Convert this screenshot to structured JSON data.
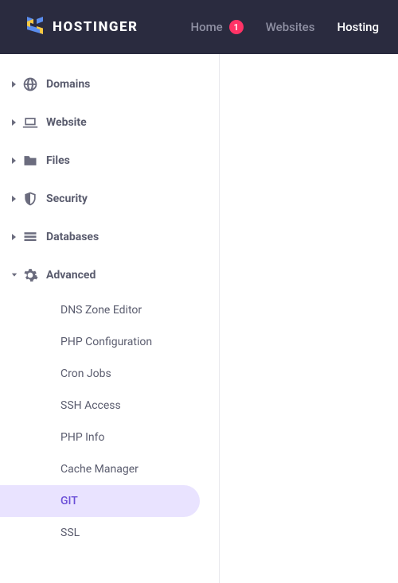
{
  "header": {
    "brand": "HOSTINGER",
    "nav": {
      "home": "Home",
      "home_badge": "1",
      "websites": "Websites",
      "hosting": "Hosting"
    }
  },
  "sidebar": {
    "items": [
      {
        "label": "Domains",
        "expanded": false
      },
      {
        "label": "Website",
        "expanded": false
      },
      {
        "label": "Files",
        "expanded": false
      },
      {
        "label": "Security",
        "expanded": false
      },
      {
        "label": "Databases",
        "expanded": false
      },
      {
        "label": "Advanced",
        "expanded": true
      }
    ],
    "advanced_submenu": [
      {
        "label": "DNS Zone Editor",
        "selected": false
      },
      {
        "label": "PHP Configuration",
        "selected": false
      },
      {
        "label": "Cron Jobs",
        "selected": false
      },
      {
        "label": "SSH Access",
        "selected": false
      },
      {
        "label": "PHP Info",
        "selected": false
      },
      {
        "label": "Cache Manager",
        "selected": false
      },
      {
        "label": "GIT",
        "selected": true
      },
      {
        "label": "SSL",
        "selected": false
      }
    ]
  }
}
